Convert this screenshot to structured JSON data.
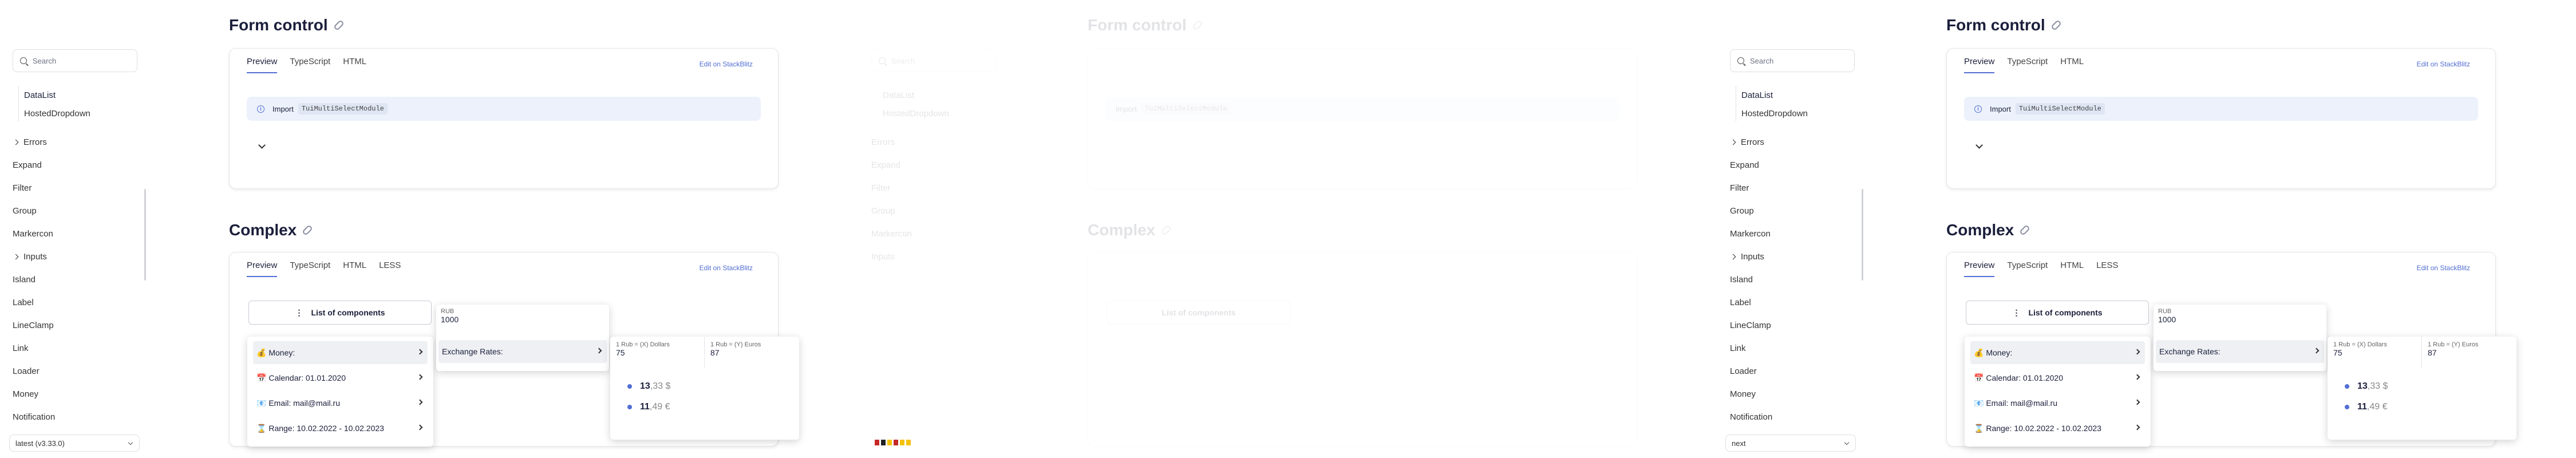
{
  "sidebar": {
    "search_placeholder": "Search",
    "sub_items": [
      "DataList",
      "HostedDropdown"
    ],
    "items": [
      "Errors",
      "Expand",
      "Filter",
      "Group",
      "Markercon",
      "Inputs",
      "Island",
      "Label",
      "LineClamp",
      "Link",
      "Loader",
      "Money",
      "Notification"
    ],
    "version_left": "latest (v3.33.0)",
    "version_right": "next"
  },
  "sections": {
    "form_control": {
      "title": "Form control",
      "tabs": [
        "Preview",
        "TypeScript",
        "HTML"
      ],
      "stackblitz": "Edit on StackBlitz",
      "import_label": "Import",
      "import_code": "TuiMultiSelectModule"
    },
    "complex": {
      "title": "Complex",
      "tabs": [
        "Preview",
        "TypeScript",
        "HTML",
        "LESS"
      ],
      "stackblitz": "Edit on StackBlitz",
      "list_button": "List of components",
      "menu": [
        {
          "icon": "💰",
          "label": "Money:"
        },
        {
          "icon": "📅",
          "label": "Calendar: 01.01.2020"
        },
        {
          "icon": "📧",
          "label": "Email: mail@mail.ru"
        },
        {
          "icon": "⌛",
          "label": "Range: 10.02.2022 - 10.02.2023"
        }
      ],
      "rub_label": "RUB",
      "rub_value": "1000",
      "exchange": "Exchange Rates:",
      "dollar_label": "1 Rub = (X) Dollars",
      "dollar_value": "75",
      "euro_label": "1 Rub = (Y) Euros",
      "euro_value": "87",
      "amount1_int": "13",
      "amount1_frac": ",33 $",
      "amount2_int": "11",
      "amount2_frac": ",49 €"
    }
  },
  "colors": {
    "accent": "#526ed3",
    "text": "#1b1f3b"
  }
}
